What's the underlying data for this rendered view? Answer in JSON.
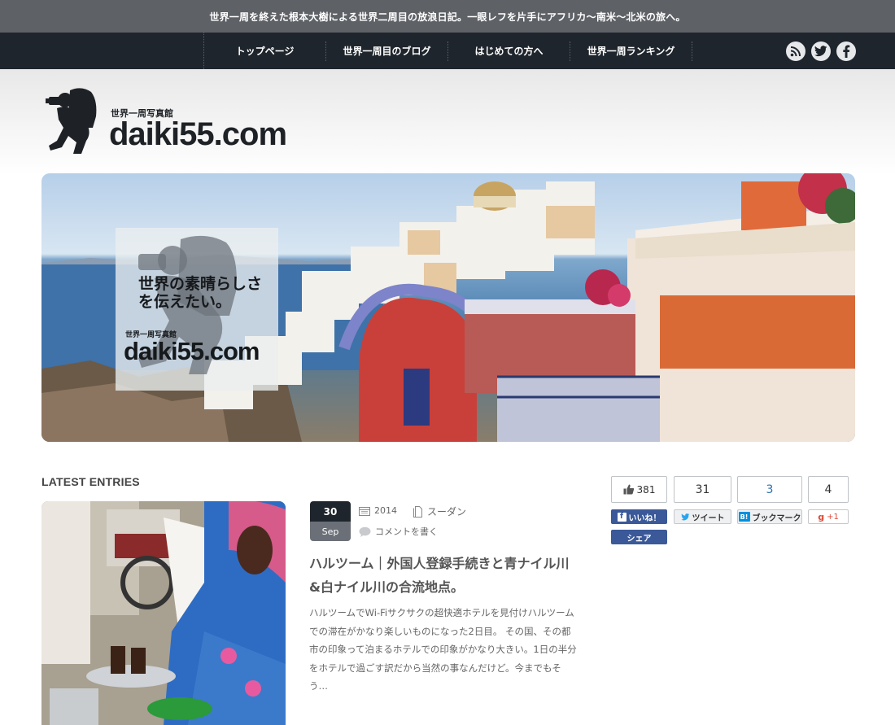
{
  "header": {
    "tagline": "世界一周を終えた根本大樹による世界二周目の放浪日記。一眼レフを片手にアフリカ〜南米〜北米の旅へ。"
  },
  "nav": {
    "items": [
      {
        "label": "トップページ"
      },
      {
        "label": "世界一周目のブログ"
      },
      {
        "label": "はじめての方へ"
      },
      {
        "label": "世界一周ランキング"
      }
    ],
    "social": [
      "rss-icon",
      "twitter-icon",
      "facebook-icon"
    ]
  },
  "logo": {
    "sub": "世界一周写真館",
    "main": "daiki55.com"
  },
  "hero": {
    "tagline": "世界の素晴らしさを伝えたい。",
    "logo_sub": "世界一周写真館",
    "logo_main": "daiki55.com"
  },
  "latest": {
    "section_title": "LATEST ENTRIES",
    "post": {
      "day": "30",
      "month": "Sep",
      "year": "2014",
      "category": "スーダン",
      "comment": "コメントを書く",
      "title": "ハルツーム｜外国人登録手続きと青ナイル川&白ナイル川の合流地点。",
      "excerpt": "ハルツームでWi-Fiサクサクの超快適ホテルを見付けハルツームでの滞在がかなり楽しいものになった2日目。 その国、その都市の印象って泊まるホテルでの印象がかなり大きい。1日の半分をホテルで過ごす訳だから当然の事なんだけど。今までもそう…"
    }
  },
  "share": {
    "like_count": "381",
    "like_label": "いいね！",
    "share_label": "シェア",
    "tweet_count": "31",
    "tweet_label": "ツイート",
    "hatena_count": "3",
    "hatena_label": "ブックマーク",
    "gplus_count": "4",
    "gplus_label": "+1"
  },
  "colors": {
    "nav_bg": "#1f252c",
    "tagline_bg": "#5e6166",
    "facebook": "#3b5998",
    "hatena": "#008fde",
    "gplus": "#dd4b39"
  }
}
